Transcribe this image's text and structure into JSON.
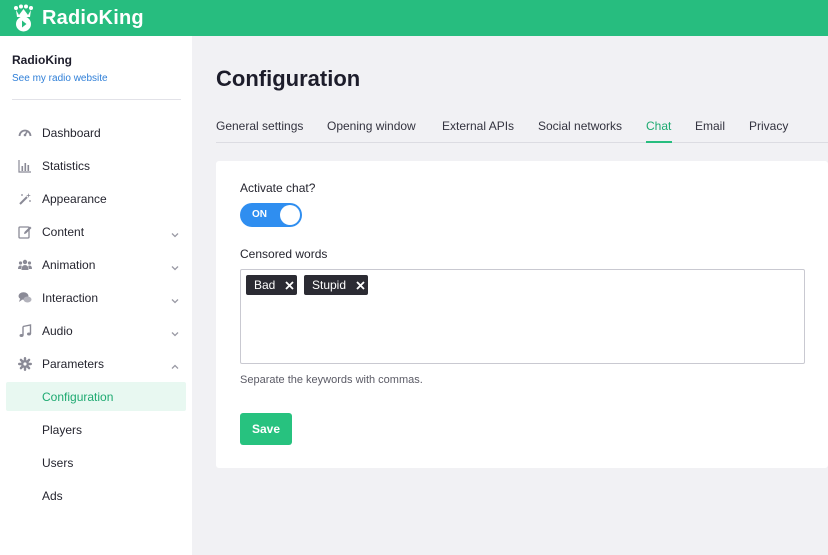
{
  "app": {
    "name": "RadioKing",
    "brand_color": "#27bd7f",
    "logo_icon": "crown-radio-icon"
  },
  "sidebar": {
    "radio_name": "RadioKing",
    "radio_link": "See my radio website",
    "items": [
      {
        "label": "Dashboard",
        "icon": "dashboard-icon",
        "expandable": false
      },
      {
        "label": "Statistics",
        "icon": "bar-chart-icon",
        "expandable": false
      },
      {
        "label": "Appearance",
        "icon": "magic-wand-icon",
        "expandable": false
      },
      {
        "label": "Content",
        "icon": "edit-icon",
        "expandable": true,
        "expanded": false
      },
      {
        "label": "Animation",
        "icon": "users-icon",
        "expandable": true,
        "expanded": false
      },
      {
        "label": "Interaction",
        "icon": "chat-icon",
        "expandable": true,
        "expanded": false
      },
      {
        "label": "Audio",
        "icon": "music-note-icon",
        "expandable": true,
        "expanded": false
      },
      {
        "label": "Parameters",
        "icon": "gear-icon",
        "expandable": true,
        "expanded": true
      }
    ],
    "sub_items": [
      {
        "label": "Configuration",
        "active": true
      },
      {
        "label": "Players",
        "active": false
      },
      {
        "label": "Users",
        "active": false
      },
      {
        "label": "Ads",
        "active": false
      }
    ]
  },
  "main": {
    "title": "Configuration",
    "tabs": [
      {
        "label": "General settings",
        "active": false
      },
      {
        "label": "Opening window",
        "active": false
      },
      {
        "label": "External APIs",
        "active": false
      },
      {
        "label": "Social networks",
        "active": false
      },
      {
        "label": "Chat",
        "active": true
      },
      {
        "label": "Email",
        "active": false
      },
      {
        "label": "Privacy",
        "active": false
      }
    ],
    "chat": {
      "activate_label": "Activate chat?",
      "toggle_state": "ON",
      "toggle_color": "#2f8ef0",
      "censored_label": "Censored words",
      "censored_words": [
        "Bad",
        "Stupid"
      ],
      "hint": "Separate the keywords with commas.",
      "save_label": "Save"
    }
  }
}
